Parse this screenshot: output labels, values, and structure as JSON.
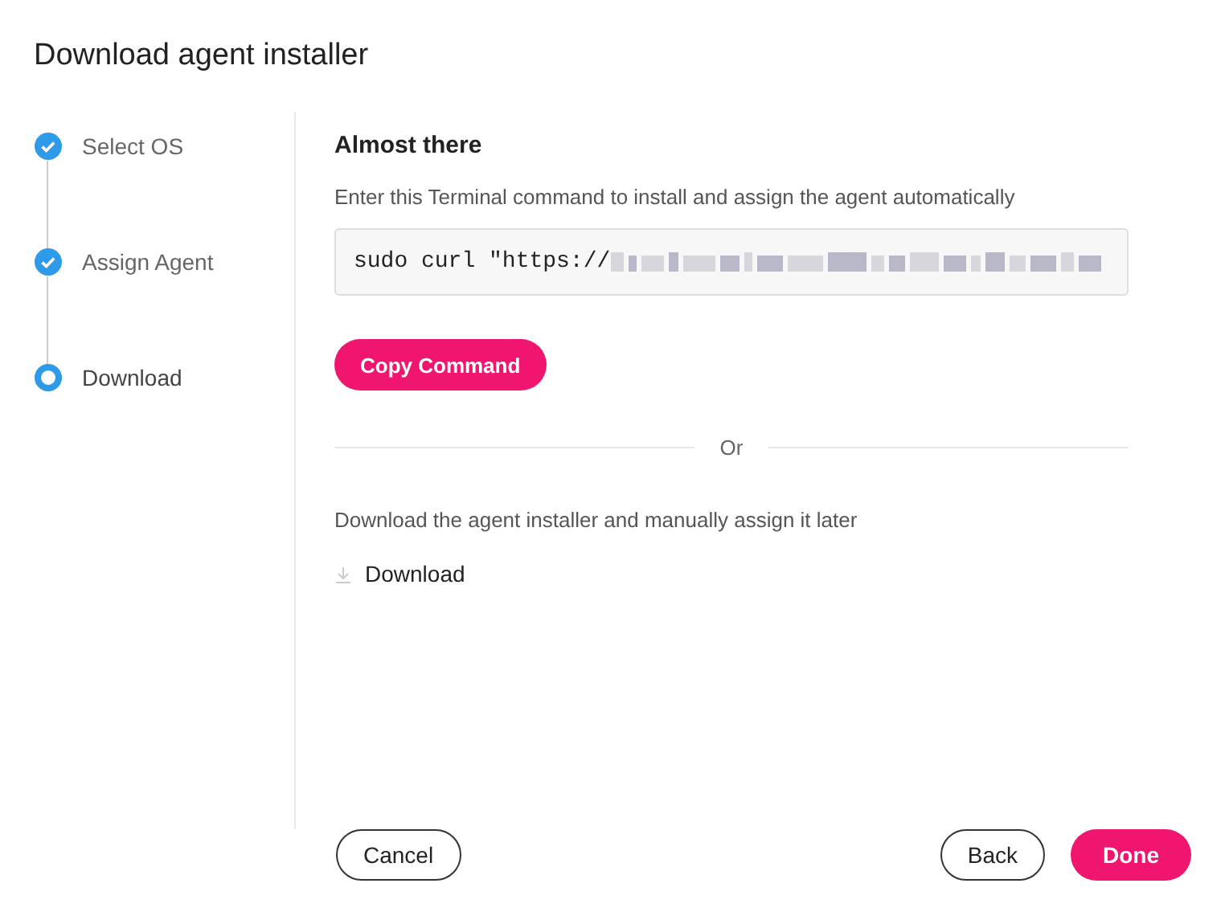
{
  "dialog": {
    "title": "Download agent installer"
  },
  "steps": [
    {
      "label": "Select OS",
      "completed": true,
      "selected": false
    },
    {
      "label": "Assign Agent",
      "completed": true,
      "selected": false
    },
    {
      "label": "Download",
      "completed": false,
      "selected": true
    }
  ],
  "content": {
    "heading": "Almost there",
    "command_hint": "Enter this Terminal command to install and assign the agent automatically",
    "command": "sudo curl \"https://",
    "command_redacted": true,
    "copy_button": "Copy Command",
    "divider_label": "Or",
    "download_hint": "Download the agent installer and manually assign it later",
    "download_link": "Download"
  },
  "footer": {
    "cancel": "Cancel",
    "back": "Back",
    "done": "Done"
  }
}
